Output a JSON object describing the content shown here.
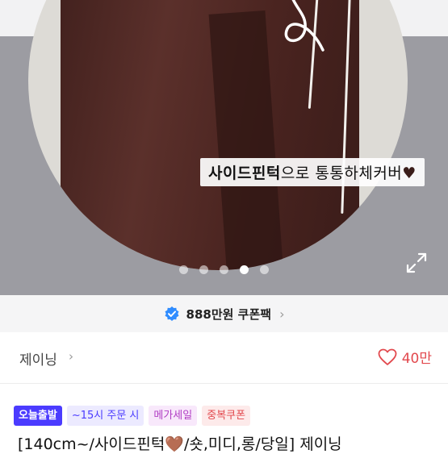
{
  "hero": {
    "caption_bold": "사이드핀턱",
    "caption_rest": "으로 통통하체커버",
    "caption_heart": "♥",
    "dots_total": 5,
    "dots_active_index": 3
  },
  "coupon": {
    "label": "888만원 쿠폰팩",
    "chevron": "›"
  },
  "shop": {
    "name": "제이닝",
    "chevron": "›",
    "likes": "40만"
  },
  "badges": [
    {
      "label": "오늘출발"
    },
    {
      "label": "~15시 주문 시"
    },
    {
      "label": "메가세일"
    },
    {
      "label": "중복쿠폰"
    }
  ],
  "product": {
    "title": "[140cm~/사이드핀턱🤎/숏,미디,롱/당일] 제이닝"
  },
  "colors": {
    "accent_blue": "#4b3bff",
    "like_red": "#e2484d",
    "verified_blue": "#2f8cff"
  }
}
